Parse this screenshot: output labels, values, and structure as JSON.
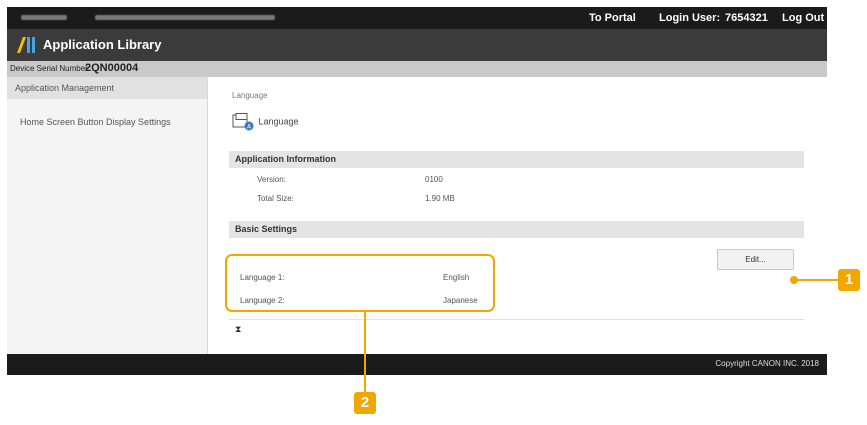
{
  "topbar": {
    "to_portal": "To Portal",
    "login_user_label": "Login User:",
    "login_user_value": "7654321",
    "log_out": "Log Out"
  },
  "app": {
    "title": "Application Library",
    "logo_icon": "app-library-logo-icon"
  },
  "device": {
    "serial_label": "Device Serial Number:",
    "serial_value": "2QN00004"
  },
  "sidebar": {
    "items": [
      {
        "label": "Application Management",
        "active": true
      },
      {
        "label": "Home Screen Button Display Settings",
        "active": false
      }
    ]
  },
  "main": {
    "header_label": "Language",
    "app_name": "Language",
    "app_icon": "language-app-icon",
    "app_info": {
      "title": "Application Information",
      "rows": [
        {
          "label": "Version:",
          "value": "0100"
        },
        {
          "label": "Total Size:",
          "value": "1.90 MB"
        }
      ]
    },
    "basic_settings": {
      "title": "Basic Settings",
      "edit_label": "Edit...",
      "rows": [
        {
          "label": "Language 1:",
          "value": "English"
        },
        {
          "label": "Language 2:",
          "value": "Japanese"
        }
      ]
    },
    "hourglass_icon": "hourglass-icon"
  },
  "footer": {
    "copyright": "Copyright CANON INC. 2018"
  },
  "callouts": {
    "one": "1",
    "two": "2",
    "color": "#f2a700"
  }
}
